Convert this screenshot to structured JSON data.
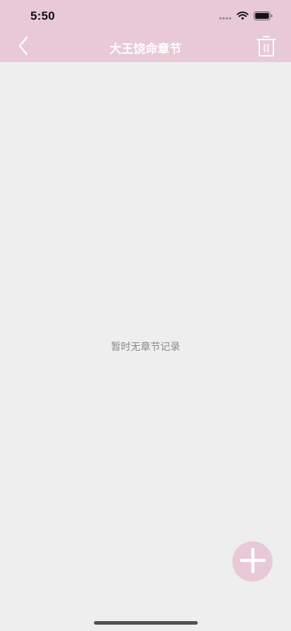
{
  "status_bar": {
    "time": "5:50",
    "icons": [
      "signal-icon",
      "wifi-icon",
      "battery-icon"
    ]
  },
  "nav": {
    "title": "大王饶命章节",
    "back_icon": "chevron-left-icon",
    "delete_icon": "trash-icon"
  },
  "content": {
    "empty_message": "暂时无章节记录"
  },
  "fab": {
    "icon": "plus-icon"
  },
  "colors": {
    "header_bg": "#e9c9d6",
    "page_bg": "#eeeeee",
    "title_text": "#ffffff",
    "empty_text": "#8a8a8a",
    "fab_bg": "#e9c9d6"
  }
}
